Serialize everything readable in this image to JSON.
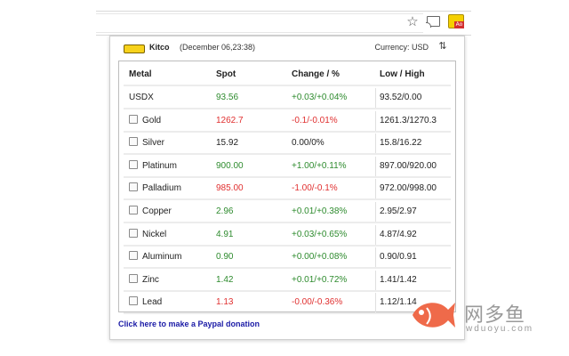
{
  "browser": {
    "star_icon": "star-icon",
    "cast_icon": "cast-icon",
    "extension_icon": "kitco-extension-icon",
    "extension_badge": "Ao"
  },
  "popup": {
    "brand": "Kitco",
    "timestamp": "(December 06,23:38)",
    "currency": "Currency: USD",
    "refresh_icon": "refresh-icon",
    "donate_link": "Click here to make a Paypal donation"
  },
  "table": {
    "headers": [
      "Metal",
      "Spot",
      "Change / %",
      "Low / High"
    ],
    "rows": [
      {
        "metal": "USDX",
        "checkbox": false,
        "spot": "93.56",
        "change": "+0.03/+0.04%",
        "lowhigh": "93.52/0.00",
        "trend": "up"
      },
      {
        "metal": "Gold",
        "checkbox": true,
        "spot": "1262.7",
        "change": "-0.1/-0.01%",
        "lowhigh": "1261.3/1270.3",
        "trend": "down"
      },
      {
        "metal": "Silver",
        "checkbox": true,
        "spot": "15.92",
        "change": "0.00/0%",
        "lowhigh": "15.8/16.22",
        "trend": "flat"
      },
      {
        "metal": "Platinum",
        "checkbox": true,
        "spot": "900.00",
        "change": "+1.00/+0.11%",
        "lowhigh": "897.00/920.00",
        "trend": "up"
      },
      {
        "metal": "Palladium",
        "checkbox": true,
        "spot": "985.00",
        "change": "-1.00/-0.1%",
        "lowhigh": "972.00/998.00",
        "trend": "down"
      },
      {
        "metal": "Copper",
        "checkbox": true,
        "spot": "2.96",
        "change": "+0.01/+0.38%",
        "lowhigh": "2.95/2.97",
        "trend": "up"
      },
      {
        "metal": "Nickel",
        "checkbox": true,
        "spot": "4.91",
        "change": "+0.03/+0.65%",
        "lowhigh": "4.87/4.92",
        "trend": "up"
      },
      {
        "metal": "Aluminum",
        "checkbox": true,
        "spot": "0.90",
        "change": "+0.00/+0.08%",
        "lowhigh": "0.90/0.91",
        "trend": "up"
      },
      {
        "metal": "Zinc",
        "checkbox": true,
        "spot": "1.42",
        "change": "+0.01/+0.72%",
        "lowhigh": "1.41/1.42",
        "trend": "up"
      },
      {
        "metal": "Lead",
        "checkbox": true,
        "spot": "1.13",
        "change": "-0.00/-0.36%",
        "lowhigh": "1.12/1.14",
        "trend": "down"
      }
    ]
  },
  "colors": {
    "up": "#2e8b2e",
    "down": "#e03030",
    "link": "#1a1aa6",
    "gold_accent": "#f7d21b"
  },
  "watermark": {
    "title": "网多鱼",
    "url": "wduoyu.com"
  }
}
